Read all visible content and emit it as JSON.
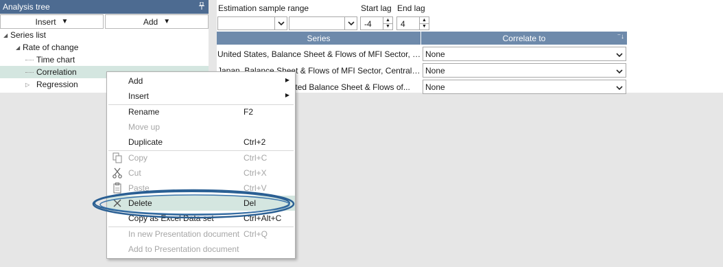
{
  "left_panel": {
    "title": "Analysis tree",
    "pin_icon": "pin-icon",
    "insert_label": "Insert",
    "add_label": "Add",
    "tree": {
      "series_list": "Series list",
      "rate_of_change": "Rate of change",
      "time_chart": "Time chart",
      "correlation": "Correlation",
      "regression": "Regression"
    }
  },
  "estimation": {
    "sample_range_label": "Estimation sample range",
    "start_lag_label": "Start lag",
    "start_lag_value": "-4",
    "end_lag_label": "End lag",
    "end_lag_value": "4"
  },
  "grid": {
    "columns": {
      "series": "Series",
      "correlate_to": "Correlate to"
    },
    "rows": [
      {
        "series": "United States, Balance Sheet & Flows of MFI Sector, Fe...",
        "correlate_to": "None"
      },
      {
        "series": "Japan, Balance Sheet & Flows of MFI Sector, Central B...",
        "correlate_to": "None"
      },
      {
        "series": "Euro Area, Consolidated Balance Sheet & Flows of...",
        "correlate_to": "None"
      }
    ]
  },
  "context_menu": {
    "items": [
      {
        "label": "Add",
        "shortcut": "",
        "submenu": true,
        "enabled": true
      },
      {
        "label": "Insert",
        "shortcut": "",
        "submenu": true,
        "enabled": true
      },
      {
        "label": "Rename",
        "shortcut": "F2",
        "enabled": true
      },
      {
        "label": "Move up",
        "shortcut": "",
        "enabled": false
      },
      {
        "label": "Duplicate",
        "shortcut": "Ctrl+2",
        "enabled": true
      },
      {
        "label": "Copy",
        "shortcut": "Ctrl+C",
        "enabled": false,
        "icon": "copy-icon"
      },
      {
        "label": "Cut",
        "shortcut": "Ctrl+X",
        "enabled": false,
        "icon": "scissors-icon"
      },
      {
        "label": "Paste",
        "shortcut": "Ctrl+V",
        "enabled": false,
        "icon": "clipboard-icon"
      },
      {
        "label": "Delete",
        "shortcut": "Del",
        "enabled": true,
        "highlighted": true,
        "icon": "close-icon"
      },
      {
        "label": "Copy as Excel Data set",
        "shortcut": "Ctrl+Alt+C",
        "enabled": true
      },
      {
        "label": "In new Presentation document",
        "shortcut": "Ctrl+Q",
        "enabled": false
      },
      {
        "label": "Add to Presentation document",
        "shortcut": "",
        "enabled": false
      }
    ]
  },
  "colors": {
    "header_blue": "#4d6b91",
    "grid_header": "#6e8aab",
    "selection": "#d4e6e0",
    "annotation_ring": "#2a5f93"
  }
}
